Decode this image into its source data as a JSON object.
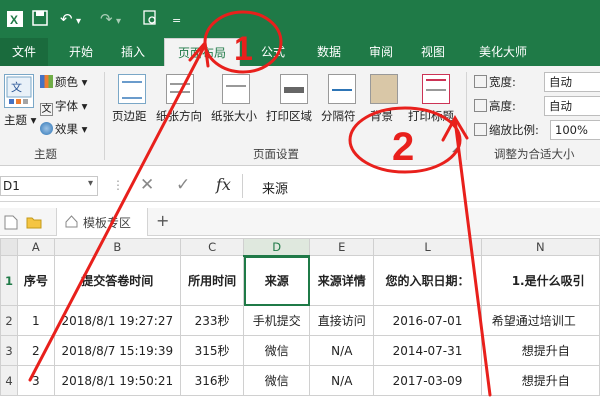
{
  "qat": {
    "undo_glyph": "↶",
    "redo_glyph": "↷",
    "more_glyph": "="
  },
  "tabs": [
    "文件",
    "开始",
    "插入",
    "页面布局",
    "公式",
    "数据",
    "审阅",
    "视图",
    "美化大师"
  ],
  "ribbon": {
    "theme_group": {
      "theme_label": "主题",
      "colors_label": "颜色",
      "fonts_label": "字体",
      "effects_label": "效果",
      "group_label": "主题"
    },
    "page_setup": {
      "margins": "页边距",
      "orientation": "纸张方向",
      "size": "纸张大小",
      "print_area": "打印区域",
      "breaks": "分隔符",
      "background": "背景",
      "print_titles": "打印标题",
      "group_label": "页面设置"
    },
    "scale": {
      "width_label": "宽度:",
      "width_value": "自动",
      "height_label": "高度:",
      "height_value": "自动",
      "scale_label": "缩放比例:",
      "scale_value": "100%",
      "group_label": "调整为合适大小"
    }
  },
  "formula_bar": {
    "name_box": "D1",
    "cancel": "✕",
    "enter": "✓",
    "fx": "fx",
    "content": "来源"
  },
  "sheet_tabs": {
    "template_label": "模板专区",
    "add": "+"
  },
  "grid": {
    "columns": [
      "A",
      "B",
      "C",
      "D",
      "E",
      "L",
      "N"
    ],
    "row_numbers": [
      "1",
      "2",
      "3",
      "4"
    ],
    "header_row": [
      "序号",
      "提交答卷时间",
      "所用时间",
      "来源",
      "来源详情",
      "您的入职日期：",
      "1.是什么吸引"
    ],
    "rows": [
      [
        "1",
        "2018/8/1 19:27:27",
        "233秒",
        "手机提交",
        "直接访问",
        "2016-07-01",
        "希望通过培训工"
      ],
      [
        "2",
        "2018/8/7 15:19:39",
        "315秒",
        "微信",
        "N/A",
        "2014-07-31",
        "想提升自"
      ],
      [
        "3",
        "2018/8/1 19:50:21",
        "316秒",
        "微信",
        "N/A",
        "2017-03-09",
        "想提升自"
      ]
    ]
  },
  "annotations": {
    "mark_1": "1",
    "mark_2": "2",
    "color": "#e8201c"
  },
  "colors": {
    "excel_green": "#1f7a47"
  }
}
